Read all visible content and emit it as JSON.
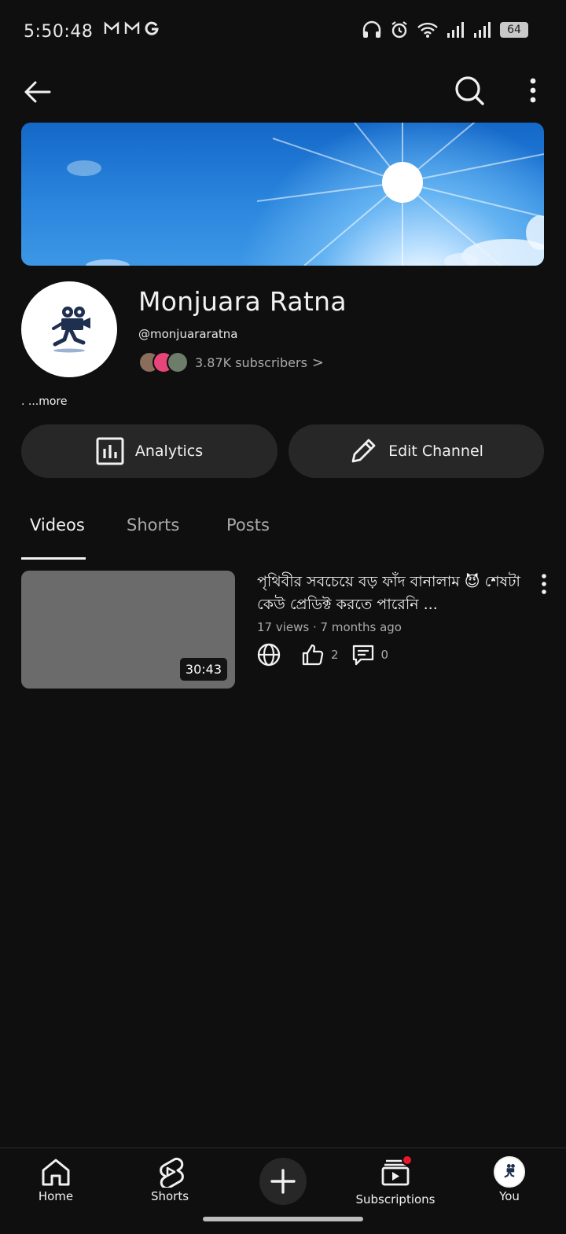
{
  "status_bar": {
    "time": "5:50:48",
    "left_icons": [
      "gmail-icon",
      "gmail-icon",
      "google-icon"
    ],
    "right_icons": [
      "headphones-icon",
      "alarm-icon",
      "wifi-icon",
      "signal-icon",
      "signal-icon"
    ],
    "battery": "64"
  },
  "app_bar": {
    "back_icon": "arrow-left-icon",
    "search_icon": "search-icon",
    "more_icon": "more-vertical-icon"
  },
  "channel": {
    "name": "Monjuara Ratna",
    "handle": "@monjuararatna",
    "subscribers": "3.87K subscribers",
    "subscribers_chevron": ">",
    "description_more": ". ...more"
  },
  "actions": {
    "analytics_label": "Analytics",
    "edit_label": "Edit Channel"
  },
  "tabs": [
    {
      "label": "Videos",
      "active": true
    },
    {
      "label": "Shorts",
      "active": false
    },
    {
      "label": "Posts",
      "active": false
    }
  ],
  "videos": [
    {
      "title": "পৃথিবীর সবচেয়ে বড় ফাঁদ বানালাম 😈 শেষটা কেউ প্রেডিক্ট করতে পারেনি ...",
      "meta": "17 views · 7 months ago",
      "duration": "30:43",
      "likes": "2",
      "comments": "0",
      "visibility_icon": "globe-icon"
    }
  ],
  "bottom_nav": {
    "home": "Home",
    "shorts": "Shorts",
    "create_icon": "plus-icon",
    "subscriptions": "Subscriptions",
    "you": "You"
  },
  "colors": {
    "background": "#0f0f0f",
    "button_bg": "#272727",
    "text_primary": "#f1f1f1",
    "text_secondary": "#aaaaaa",
    "accent_red": "#e5192a"
  }
}
